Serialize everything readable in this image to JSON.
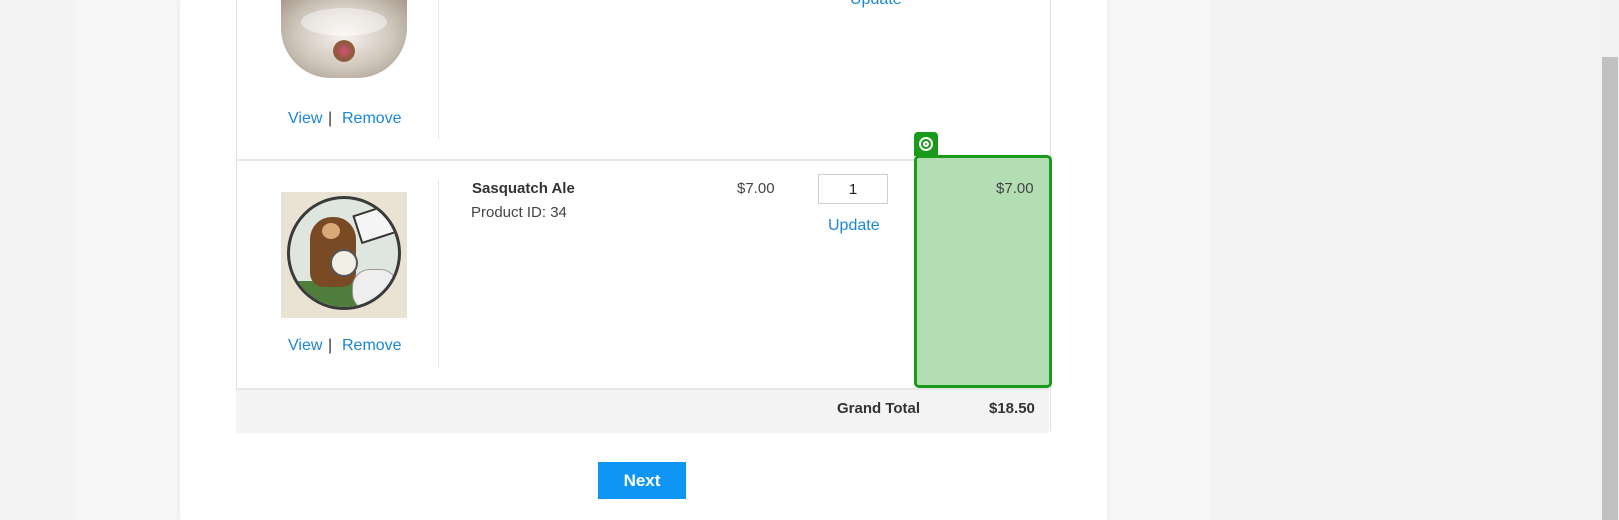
{
  "cart": {
    "items": [
      {
        "image_alt": "Blooming tea in glass teapot",
        "view_label": "View",
        "separator": "|",
        "remove_label": "Remove",
        "update_label": "Update"
      },
      {
        "image_alt": "Sasquatch Ale label",
        "name": "Sasquatch Ale",
        "product_id": "Product ID: 34",
        "price": "$7.00",
        "quantity": "1",
        "update_label": "Update",
        "subtotal": "$7.00",
        "view_label": "View",
        "separator": "|",
        "remove_label": "Remove"
      }
    ],
    "grand_total_label": "Grand Total",
    "grand_total_value": "$18.50"
  },
  "actions": {
    "next_label": "Next"
  },
  "highlight": {
    "color": "#1a9a1a",
    "fill": "#b3ddb3",
    "icon": "target-icon"
  },
  "colors": {
    "link": "#1a86d8",
    "primary_button": "#0f95f3"
  }
}
